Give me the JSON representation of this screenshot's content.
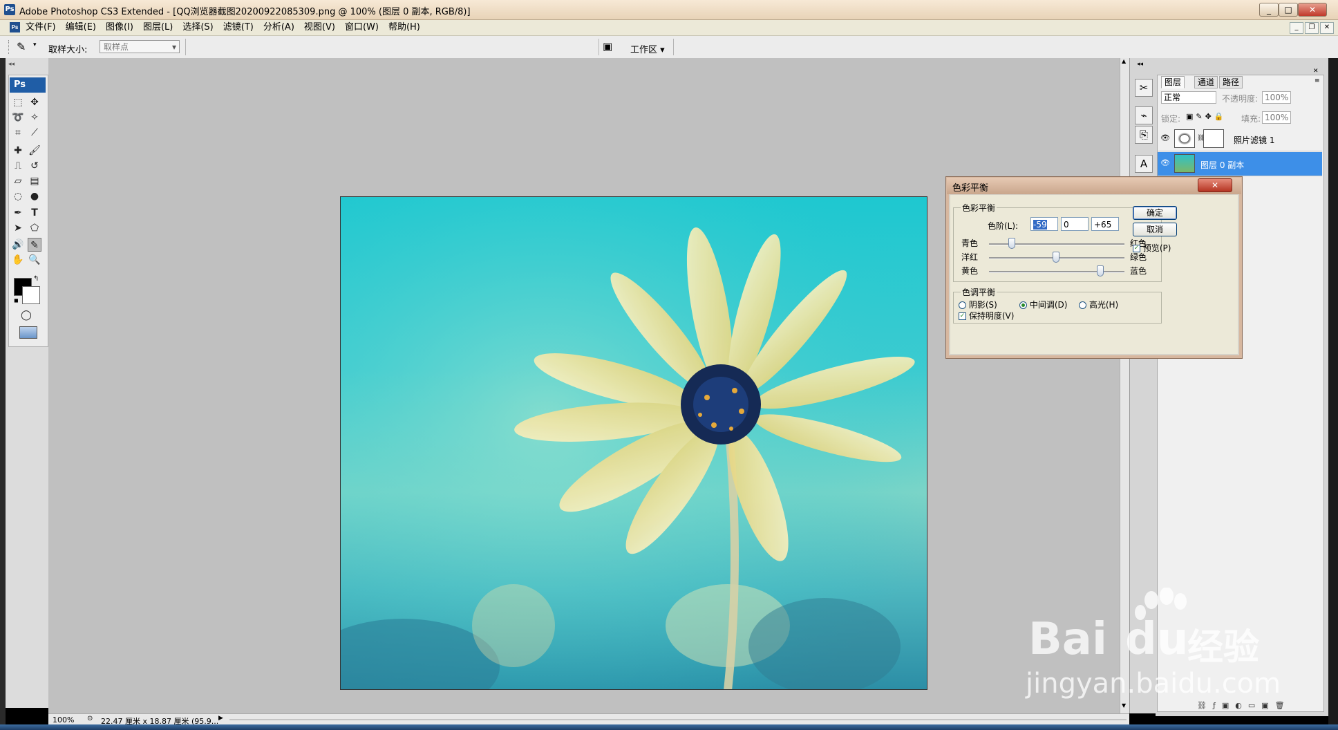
{
  "window": {
    "title": "Adobe Photoshop CS3 Extended - [QQ浏览器截图20200922085309.png @ 100% (图层 0 副本, RGB/8)]",
    "logo": "Ps"
  },
  "menubar": {
    "items": [
      "文件(F)",
      "编辑(E)",
      "图像(I)",
      "图层(L)",
      "选择(S)",
      "滤镜(T)",
      "分析(A)",
      "视图(V)",
      "窗口(W)",
      "帮助(H)"
    ]
  },
  "options": {
    "sample_size_label": "取样大小:",
    "sample_size_value": "取样点",
    "workspace_label": "工作区 ▾"
  },
  "toolbox": {
    "badge": "Ps"
  },
  "statusbar": {
    "zoom": "100%",
    "doc_info": "22.47 厘米 x 18.87 厘米 (95.9..."
  },
  "layers_panel": {
    "tabs": [
      "图层",
      "通道",
      "路径"
    ],
    "blend_mode": "正常",
    "opacity_label": "不透明度:",
    "opacity_value": "100%",
    "lock_label": "锁定:",
    "fill_label": "填充:",
    "fill_value": "100%",
    "layers": [
      {
        "name": "照片滤镜 1",
        "selected": false
      },
      {
        "name": "图层 0 副本",
        "selected": true
      }
    ]
  },
  "dialog": {
    "title": "色彩平衡",
    "close": "✕",
    "color_balance_group": "色彩平衡",
    "levels_label": "色阶(L):",
    "levels": [
      "-59",
      "0",
      "+65"
    ],
    "sliders": [
      {
        "left": "青色",
        "right": "红色",
        "value": -59
      },
      {
        "left": "洋红",
        "right": "绿色",
        "value": 0
      },
      {
        "left": "黄色",
        "right": "蓝色",
        "value": 65
      }
    ],
    "tone_group": "色调平衡",
    "tone_options": [
      "阴影(S)",
      "中间调(D)",
      "高光(H)"
    ],
    "tone_selected": 1,
    "preserve_luminosity": "保持明度(V)",
    "preserve_checked": true,
    "ok": "确定",
    "cancel": "取消",
    "preview": "预览(P)",
    "preview_checked": true
  },
  "watermark": {
    "brand": "Bai",
    "brand2": "du",
    "cn": "经验",
    "url": "jingyan.baidu.com"
  },
  "colors": {
    "accent": "#3d8fe8",
    "titlebar": "#e8d3b7",
    "canvas_bg": "#c0c0c0"
  }
}
